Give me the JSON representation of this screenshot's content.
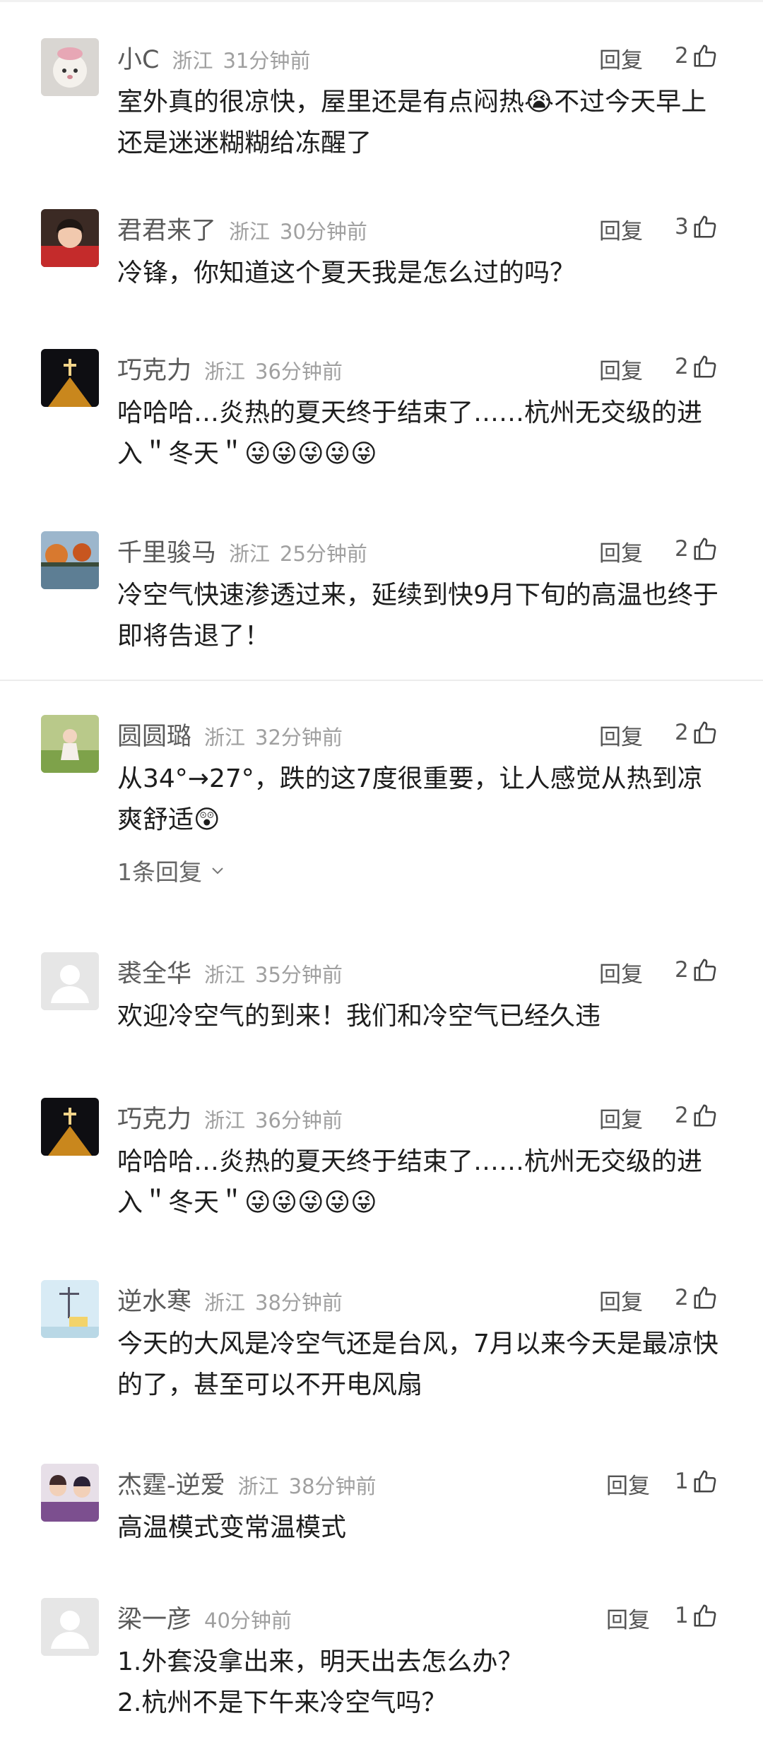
{
  "comments": [
    {
      "user": "小C",
      "region": "浙江",
      "time": "31分钟前",
      "reply": "回复",
      "likes": "2",
      "text": "室外真的很凉快，屋里还是有点闷热😭不过今天早上还是迷迷糊糊给冻醒了"
    },
    {
      "user": "君君来了",
      "region": "浙江",
      "time": "30分钟前",
      "reply": "回复",
      "likes": "3",
      "text": "冷锋，你知道这个夏天我是怎么过的吗？"
    },
    {
      "user": "巧克力",
      "region": "浙江",
      "time": "36分钟前",
      "reply": "回复",
      "likes": "2",
      "text": "哈哈哈…炎热的夏天终于结束了……杭州无交级的进入＂冬天＂😜😜😜😜😜"
    },
    {
      "user": "千里骏马",
      "region": "浙江",
      "time": "25分钟前",
      "reply": "回复",
      "likes": "2",
      "text": "冷空气快速渗透过来，延续到快9月下旬的高温也终于即将告退了！"
    },
    {
      "user": "圆圆璐",
      "region": "浙江",
      "time": "32分钟前",
      "reply": "回复",
      "likes": "2",
      "text": "从34°→27°，跌的这7度很重要，让人感觉从热到凉爽舒适😲",
      "sub_replies": "1条回复"
    },
    {
      "user": "裘全华",
      "region": "浙江",
      "time": "35分钟前",
      "reply": "回复",
      "likes": "2",
      "text": "欢迎冷空气的到来！我们和冷空气已经久违"
    },
    {
      "user": "巧克力",
      "region": "浙江",
      "time": "36分钟前",
      "reply": "回复",
      "likes": "2",
      "text": "哈哈哈…炎热的夏天终于结束了……杭州无交级的进入＂冬天＂😜😜😜😜😜"
    },
    {
      "user": "逆水寒",
      "region": "浙江",
      "time": "38分钟前",
      "reply": "回复",
      "likes": "2",
      "text": "今天的大风是冷空气还是台风，7月以来今天是最凉快的了，甚至可以不开电风扇"
    },
    {
      "user": "杰霆-逆爱",
      "region": "浙江",
      "time": "38分钟前",
      "reply": "回复",
      "likes": "1",
      "text": "高温模式变常温模式"
    },
    {
      "user": "梁一彦",
      "region": "",
      "time": "40分钟前",
      "reply": "回复",
      "likes": "1",
      "text": "1.外套没拿出来，明天出去怎么办？\n2.杭州不是下午来冷空气吗？"
    }
  ]
}
